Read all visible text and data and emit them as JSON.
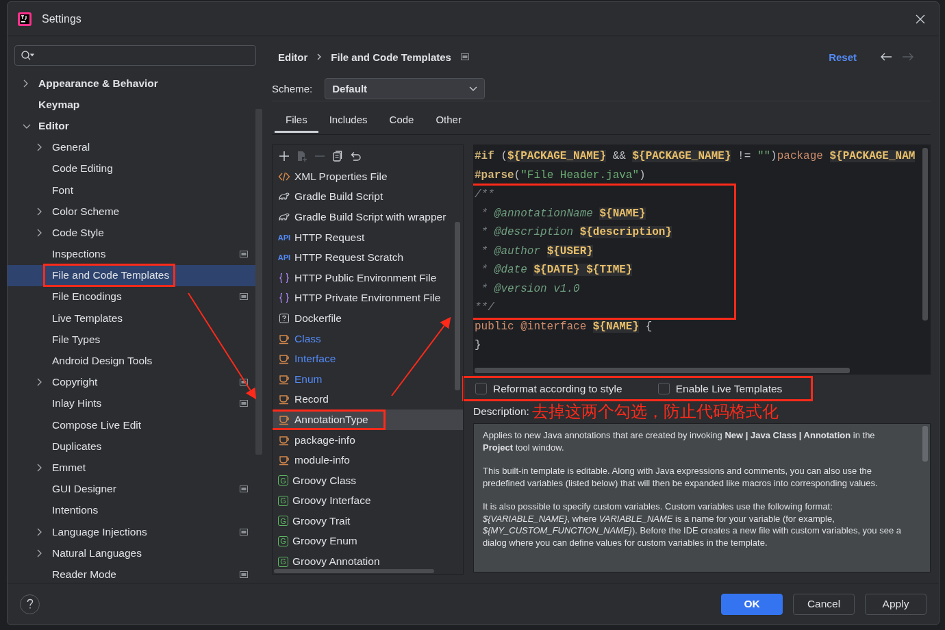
{
  "window": {
    "title": "Settings"
  },
  "sidebar": {
    "items": [
      {
        "label": "Appearance & Behavior",
        "expanded": false,
        "selected": false,
        "circled": false
      },
      {
        "label": "Keymap",
        "selected": false,
        "circled": false
      },
      {
        "label": "Editor",
        "expanded": true,
        "selected": false,
        "circled": false,
        "children": [
          {
            "label": "General",
            "expanded": false,
            "selected": false,
            "scoped": false,
            "circled": false
          },
          {
            "label": "Code Editing",
            "selected": false,
            "scoped": false,
            "circled": false
          },
          {
            "label": "Font",
            "selected": false,
            "scoped": false,
            "circled": false
          },
          {
            "label": "Color Scheme",
            "expanded": false,
            "selected": false,
            "scoped": false,
            "circled": false
          },
          {
            "label": "Code Style",
            "expanded": false,
            "selected": false,
            "scoped": false,
            "circled": false
          },
          {
            "label": "Inspections",
            "selected": false,
            "scoped": true,
            "circled": false
          },
          {
            "label": "File and Code Templates",
            "selected": true,
            "scoped": false,
            "circled": true
          },
          {
            "label": "File Encodings",
            "selected": false,
            "scoped": true,
            "circled": false
          },
          {
            "label": "Live Templates",
            "selected": false,
            "scoped": false,
            "circled": false
          },
          {
            "label": "File Types",
            "selected": false,
            "scoped": false,
            "circled": false
          },
          {
            "label": "Android Design Tools",
            "selected": false,
            "scoped": false,
            "circled": false
          },
          {
            "label": "Copyright",
            "expanded": false,
            "selected": false,
            "scoped": true,
            "circled": false
          },
          {
            "label": "Inlay Hints",
            "selected": false,
            "scoped": true,
            "circled": false
          },
          {
            "label": "Compose Live Edit",
            "selected": false,
            "scoped": false,
            "circled": false
          },
          {
            "label": "Duplicates",
            "selected": false,
            "scoped": false,
            "circled": false
          },
          {
            "label": "Emmet",
            "expanded": false,
            "selected": false,
            "scoped": false,
            "circled": false
          },
          {
            "label": "GUI Designer",
            "selected": false,
            "scoped": true,
            "circled": false
          },
          {
            "label": "Intentions",
            "selected": false,
            "scoped": false,
            "circled": false
          },
          {
            "label": "Language Injections",
            "expanded": false,
            "selected": false,
            "scoped": true,
            "circled": false
          },
          {
            "label": "Natural Languages",
            "expanded": false,
            "selected": false,
            "scoped": false,
            "circled": false
          },
          {
            "label": "Reader Mode",
            "selected": false,
            "scoped": true,
            "circled": false
          }
        ]
      }
    ]
  },
  "breadcrumb": [
    "Editor",
    "File and Code Templates"
  ],
  "reset": "Reset",
  "scheme": {
    "label": "Scheme:",
    "value": "Default"
  },
  "tabs": [
    {
      "label": "Files",
      "selected": true
    },
    {
      "label": "Includes",
      "selected": false
    },
    {
      "label": "Code",
      "selected": false
    },
    {
      "label": "Other",
      "selected": false
    }
  ],
  "toolbar": [
    {
      "kind": "plus",
      "disabled": false
    },
    {
      "kind": "add-child",
      "disabled": true
    },
    {
      "kind": "minus",
      "disabled": true
    },
    {
      "kind": "copy",
      "disabled": false
    },
    {
      "kind": "revert",
      "disabled": false
    }
  ],
  "templates": [
    {
      "label": "XML Properties File",
      "kind": "xml",
      "modified": false,
      "selected": false,
      "circled": false
    },
    {
      "label": "Gradle Build Script",
      "kind": "gradle",
      "modified": false,
      "selected": false,
      "circled": false
    },
    {
      "label": "Gradle Build Script with wrapper",
      "kind": "gradle",
      "modified": false,
      "selected": false,
      "circled": false
    },
    {
      "label": "HTTP Request",
      "kind": "api",
      "glyph": "API",
      "modified": false,
      "selected": false,
      "circled": false
    },
    {
      "label": "HTTP Request Scratch",
      "kind": "api",
      "glyph": "API",
      "modified": false,
      "selected": false,
      "circled": false
    },
    {
      "label": "HTTP Public Environment File",
      "kind": "braces",
      "modified": false,
      "selected": false,
      "circled": false
    },
    {
      "label": "HTTP Private Environment File",
      "kind": "braces",
      "modified": false,
      "selected": false,
      "circled": false
    },
    {
      "label": "Dockerfile",
      "kind": "unknown",
      "modified": false,
      "selected": false,
      "circled": false
    },
    {
      "label": "Class",
      "kind": "java",
      "modified": true,
      "selected": false,
      "circled": false
    },
    {
      "label": "Interface",
      "kind": "java",
      "modified": true,
      "selected": false,
      "circled": false
    },
    {
      "label": "Enum",
      "kind": "java",
      "modified": true,
      "selected": false,
      "circled": false
    },
    {
      "label": "Record",
      "kind": "java",
      "modified": false,
      "selected": false,
      "circled": false
    },
    {
      "label": "AnnotationType",
      "kind": "java",
      "modified": false,
      "selected": true,
      "circled": true
    },
    {
      "label": "package-info",
      "kind": "java",
      "modified": false,
      "selected": false,
      "circled": false
    },
    {
      "label": "module-info",
      "kind": "java",
      "modified": false,
      "selected": false,
      "circled": false
    },
    {
      "label": "Groovy Class",
      "kind": "groovy",
      "glyph": "G",
      "modified": false,
      "selected": false,
      "circled": false
    },
    {
      "label": "Groovy Interface",
      "kind": "groovy",
      "glyph": "G",
      "modified": false,
      "selected": false,
      "circled": false
    },
    {
      "label": "Groovy Trait",
      "kind": "groovy",
      "glyph": "G",
      "modified": false,
      "selected": false,
      "circled": false
    },
    {
      "label": "Groovy Enum",
      "kind": "groovy",
      "glyph": "G",
      "modified": false,
      "selected": false,
      "circled": false
    },
    {
      "label": "Groovy Annotation",
      "kind": "groovy",
      "glyph": "G",
      "modified": false,
      "selected": false,
      "circled": false
    }
  ],
  "code": [
    {
      "circled": false,
      "tokens": [
        {
          "text": "#if",
          "kind": "directive"
        },
        {
          "text": " (",
          "kind": "plain"
        },
        {
          "text": "${PACKAGE_NAME}",
          "kind": "var"
        },
        {
          "text": " && ",
          "kind": "plain"
        },
        {
          "text": "${PACKAGE_NAME}",
          "kind": "var"
        },
        {
          "text": " != ",
          "kind": "plain"
        },
        {
          "text": "\"\"",
          "kind": "string"
        },
        {
          "text": ")",
          "kind": "plain"
        },
        {
          "text": "package ",
          "kind": "keyword"
        },
        {
          "text": "${PACKAGE_NAM",
          "kind": "var"
        }
      ]
    },
    {
      "circled": false,
      "tokens": [
        {
          "text": "#parse",
          "kind": "directive"
        },
        {
          "text": "(",
          "kind": "plain"
        },
        {
          "text": "\"File Header.java\"",
          "kind": "string"
        },
        {
          "text": ")",
          "kind": "plain"
        }
      ]
    },
    {
      "circled": true,
      "tokens": [
        {
          "text": "/**",
          "kind": "comment"
        }
      ]
    },
    {
      "circled": true,
      "tokens": [
        {
          "text": " * ",
          "kind": "comment"
        },
        {
          "text": "@annotationName ",
          "kind": "doctag"
        },
        {
          "text": "${NAME}",
          "kind": "var"
        }
      ]
    },
    {
      "circled": true,
      "tokens": [
        {
          "text": " * ",
          "kind": "comment"
        },
        {
          "text": "@description ",
          "kind": "doctag"
        },
        {
          "text": "${description}",
          "kind": "var"
        }
      ]
    },
    {
      "circled": true,
      "tokens": [
        {
          "text": " * ",
          "kind": "comment"
        },
        {
          "text": "@author ",
          "kind": "doctag"
        },
        {
          "text": "${USER}",
          "kind": "var"
        }
      ]
    },
    {
      "circled": true,
      "tokens": [
        {
          "text": " * ",
          "kind": "comment"
        },
        {
          "text": "@date ",
          "kind": "doctag"
        },
        {
          "text": "${DATE}",
          "kind": "var"
        },
        {
          "text": " ${TIME}",
          "kind": "var"
        }
      ]
    },
    {
      "circled": true,
      "tokens": [
        {
          "text": " * ",
          "kind": "comment"
        },
        {
          "text": "@version v1.0",
          "kind": "doctag"
        }
      ]
    },
    {
      "circled": true,
      "tokens": [
        {
          "text": "**/",
          "kind": "comment"
        }
      ]
    },
    {
      "circled": false,
      "tokens": [
        {
          "text": "public @interface ",
          "kind": "keyword"
        },
        {
          "text": "${NAME}",
          "kind": "var"
        },
        {
          "text": " {",
          "kind": "plain"
        }
      ]
    },
    {
      "circled": false,
      "tokens": [
        {
          "text": "}",
          "kind": "plain"
        }
      ]
    }
  ],
  "options": {
    "circled": true,
    "items": [
      {
        "label": "Reformat according to style",
        "checked": false
      },
      {
        "label": "Enable Live Templates",
        "checked": false
      }
    ]
  },
  "description": {
    "label": "Description:",
    "annotation": "去掉这两个勾选，防止代码格式化",
    "paragraphs": [
      "Applies to new Java annotations that are created by invoking **New | Java Class | Annotation** in the **Project** tool window.",
      "This built-in template is editable. Along with Java expressions and comments, you can also use the predefined variables (listed below) that will then be expanded like macros into corresponding values.",
      "It is also possible to specify custom variables. Custom variables use the following format: *${VARIABLE_NAME}*, where *VARIABLE_NAME* is a name for your variable (for example, *${MY_CUSTOM_FUNCTION_NAME}*). Before the IDE creates a new file with custom variables, you see a dialog where you can define values for custom variables in the template."
    ]
  },
  "buttons": [
    {
      "label": "OK",
      "primary": true
    },
    {
      "label": "Cancel",
      "primary": false
    },
    {
      "label": "Apply",
      "primary": false
    }
  ]
}
